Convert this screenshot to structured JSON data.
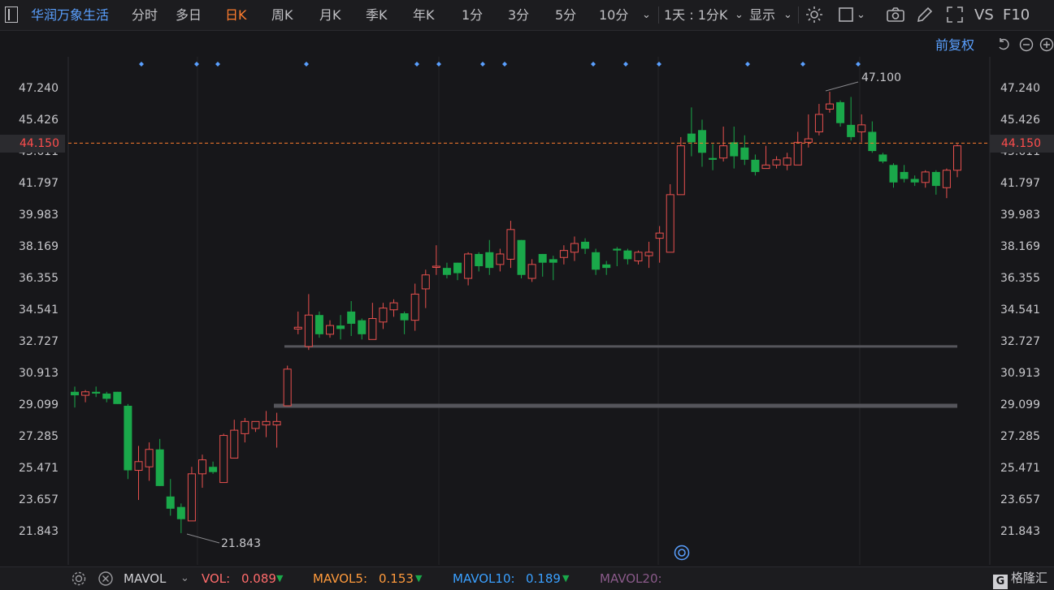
{
  "toolbar": {
    "stock_name": "华润万象生活",
    "periods": [
      "分时",
      "多日",
      "日K",
      "周K",
      "月K",
      "季K",
      "年K",
      "1分",
      "3分",
      "5分",
      "10分"
    ],
    "active_period": "日K",
    "interval_label": "1天 : 1分K",
    "display_label": "显示",
    "vs_label": "VS",
    "f10_label": "F10"
  },
  "subheader": {
    "adjust_label": "前复权"
  },
  "price_axis": {
    "labels": [
      "47.240",
      "45.426",
      "43.611",
      "41.797",
      "39.983",
      "38.169",
      "36.355",
      "34.541",
      "32.727",
      "30.913",
      "29.099",
      "27.285",
      "25.471",
      "23.657",
      "21.843"
    ]
  },
  "current_price": "44.150",
  "annotations": {
    "high_label": "47.100",
    "low_label": "21.843"
  },
  "colors": {
    "up": "#e8504e",
    "down": "#1aa84a",
    "accent": "#ff7d2e",
    "blue": "#5aa0ff",
    "current_price": "#ff4d4d"
  },
  "chart_data": {
    "type": "candlestick",
    "ylim": [
      21.0,
      48.0
    ],
    "candles": [
      {
        "o": 29.9,
        "c": 29.7,
        "h": 30.2,
        "l": 29.0
      },
      {
        "o": 29.7,
        "c": 29.9,
        "h": 30.0,
        "l": 29.3
      },
      {
        "o": 29.9,
        "c": 29.8,
        "h": 30.2,
        "l": 29.6
      },
      {
        "o": 29.8,
        "c": 29.5,
        "h": 29.9,
        "l": 29.3
      },
      {
        "o": 29.9,
        "c": 29.2,
        "h": 29.9,
        "l": 29.2
      },
      {
        "o": 29.1,
        "c": 25.4,
        "h": 29.2,
        "l": 24.9
      },
      {
        "o": 25.4,
        "c": 25.9,
        "h": 26.8,
        "l": 23.7
      },
      {
        "o": 25.6,
        "c": 26.6,
        "h": 27.0,
        "l": 24.8
      },
      {
        "o": 26.6,
        "c": 24.5,
        "h": 27.2,
        "l": 24.5
      },
      {
        "o": 23.9,
        "c": 23.2,
        "h": 24.9,
        "l": 22.8
      },
      {
        "o": 23.3,
        "c": 22.6,
        "h": 23.5,
        "l": 21.8
      },
      {
        "o": 22.5,
        "c": 25.2,
        "h": 25.6,
        "l": 22.5
      },
      {
        "o": 25.2,
        "c": 26.0,
        "h": 26.3,
        "l": 24.4
      },
      {
        "o": 25.6,
        "c": 25.3,
        "h": 25.9,
        "l": 25.2
      },
      {
        "o": 24.7,
        "c": 27.4,
        "h": 27.5,
        "l": 24.7
      },
      {
        "o": 26.1,
        "c": 27.7,
        "h": 28.3,
        "l": 26.1
      },
      {
        "o": 27.5,
        "c": 28.2,
        "h": 28.4,
        "l": 27.0
      },
      {
        "o": 27.8,
        "c": 28.2,
        "h": 28.2,
        "l": 27.6
      },
      {
        "o": 28.0,
        "c": 28.2,
        "h": 28.8,
        "l": 27.3
      },
      {
        "o": 28.0,
        "c": 28.2,
        "h": 28.7,
        "l": 26.7
      },
      {
        "o": 29.1,
        "c": 31.2,
        "h": 31.4,
        "l": 29.1
      },
      {
        "o": 33.5,
        "c": 33.6,
        "h": 34.5,
        "l": 33.2
      },
      {
        "o": 32.5,
        "c": 34.3,
        "h": 35.5,
        "l": 32.3
      },
      {
        "o": 34.3,
        "c": 33.2,
        "h": 34.5,
        "l": 33.0
      },
      {
        "o": 33.2,
        "c": 33.7,
        "h": 34.0,
        "l": 33.0
      },
      {
        "o": 33.7,
        "c": 33.5,
        "h": 34.3,
        "l": 32.9
      },
      {
        "o": 34.5,
        "c": 33.8,
        "h": 35.1,
        "l": 33.1
      },
      {
        "o": 34.0,
        "c": 33.2,
        "h": 34.1,
        "l": 32.9
      },
      {
        "o": 32.9,
        "c": 34.1,
        "h": 35.0,
        "l": 32.9
      },
      {
        "o": 33.9,
        "c": 34.7,
        "h": 35.0,
        "l": 33.5
      },
      {
        "o": 34.6,
        "c": 35.0,
        "h": 35.2,
        "l": 34.2
      },
      {
        "o": 34.4,
        "c": 34.0,
        "h": 34.5,
        "l": 33.2
      },
      {
        "o": 34.0,
        "c": 35.5,
        "h": 36.1,
        "l": 33.4
      },
      {
        "o": 35.8,
        "c": 36.6,
        "h": 36.9,
        "l": 34.7
      },
      {
        "o": 37.1,
        "c": 37.1,
        "h": 38.3,
        "l": 36.6
      },
      {
        "o": 37.0,
        "c": 36.6,
        "h": 37.3,
        "l": 36.4
      },
      {
        "o": 37.3,
        "c": 36.7,
        "h": 37.3,
        "l": 36.3
      },
      {
        "o": 36.4,
        "c": 37.8,
        "h": 37.9,
        "l": 36.0
      },
      {
        "o": 37.8,
        "c": 37.1,
        "h": 37.9,
        "l": 36.8
      },
      {
        "o": 37.9,
        "c": 37.0,
        "h": 38.6,
        "l": 36.6
      },
      {
        "o": 37.2,
        "c": 37.8,
        "h": 38.1,
        "l": 36.8
      },
      {
        "o": 37.5,
        "c": 39.2,
        "h": 39.7,
        "l": 37.0
      },
      {
        "o": 38.6,
        "c": 36.6,
        "h": 38.6,
        "l": 36.4
      },
      {
        "o": 36.4,
        "c": 37.2,
        "h": 37.5,
        "l": 36.2
      },
      {
        "o": 37.8,
        "c": 37.3,
        "h": 37.8,
        "l": 36.5
      },
      {
        "o": 37.5,
        "c": 37.3,
        "h": 37.7,
        "l": 36.3
      },
      {
        "o": 37.6,
        "c": 38.0,
        "h": 38.3,
        "l": 37.2
      },
      {
        "o": 37.9,
        "c": 38.4,
        "h": 38.8,
        "l": 37.4
      },
      {
        "o": 38.5,
        "c": 38.1,
        "h": 38.7,
        "l": 37.8
      },
      {
        "o": 37.9,
        "c": 36.9,
        "h": 38.1,
        "l": 36.6
      },
      {
        "o": 37.2,
        "c": 37.0,
        "h": 37.4,
        "l": 36.6
      },
      {
        "o": 38.1,
        "c": 38.0,
        "h": 38.2,
        "l": 37.1
      },
      {
        "o": 38.0,
        "c": 37.5,
        "h": 38.1,
        "l": 37.2
      },
      {
        "o": 37.4,
        "c": 37.9,
        "h": 38.0,
        "l": 37.2
      },
      {
        "o": 37.7,
        "c": 37.9,
        "h": 38.5,
        "l": 37.0
      },
      {
        "o": 38.7,
        "c": 39.0,
        "h": 39.4,
        "l": 37.3
      },
      {
        "o": 37.9,
        "c": 41.2,
        "h": 41.8,
        "l": 37.9
      },
      {
        "o": 41.2,
        "c": 44.0,
        "h": 44.5,
        "l": 41.2
      },
      {
        "o": 44.7,
        "c": 44.2,
        "h": 46.2,
        "l": 43.4
      },
      {
        "o": 44.9,
        "c": 43.6,
        "h": 45.5,
        "l": 42.8
      },
      {
        "o": 43.3,
        "c": 43.2,
        "h": 44.1,
        "l": 42.6
      },
      {
        "o": 43.3,
        "c": 44.0,
        "h": 45.1,
        "l": 43.1
      },
      {
        "o": 44.2,
        "c": 43.4,
        "h": 45.1,
        "l": 42.7
      },
      {
        "o": 43.9,
        "c": 43.2,
        "h": 44.6,
        "l": 42.9
      },
      {
        "o": 43.2,
        "c": 42.5,
        "h": 43.5,
        "l": 42.3
      },
      {
        "o": 42.7,
        "c": 42.9,
        "h": 44.0,
        "l": 42.7
      },
      {
        "o": 42.9,
        "c": 43.2,
        "h": 43.4,
        "l": 42.7
      },
      {
        "o": 42.9,
        "c": 43.3,
        "h": 43.6,
        "l": 42.6
      },
      {
        "o": 42.9,
        "c": 44.2,
        "h": 44.8,
        "l": 42.9
      },
      {
        "o": 44.2,
        "c": 44.4,
        "h": 45.8,
        "l": 43.9
      },
      {
        "o": 44.8,
        "c": 45.8,
        "h": 46.4,
        "l": 44.6
      },
      {
        "o": 46.1,
        "c": 46.4,
        "h": 47.1,
        "l": 45.9
      },
      {
        "o": 46.5,
        "c": 45.3,
        "h": 46.6,
        "l": 45.1
      },
      {
        "o": 45.2,
        "c": 44.5,
        "h": 46.8,
        "l": 44.3
      },
      {
        "o": 44.8,
        "c": 45.2,
        "h": 45.8,
        "l": 44.2
      },
      {
        "o": 44.8,
        "c": 43.7,
        "h": 45.4,
        "l": 43.6
      },
      {
        "o": 43.5,
        "c": 43.1,
        "h": 43.6,
        "l": 43.0
      },
      {
        "o": 42.9,
        "c": 41.9,
        "h": 43.0,
        "l": 41.6
      },
      {
        "o": 42.5,
        "c": 42.1,
        "h": 42.9,
        "l": 41.9
      },
      {
        "o": 42.1,
        "c": 41.9,
        "h": 42.3,
        "l": 41.7
      },
      {
        "o": 41.9,
        "c": 42.5,
        "h": 42.6,
        "l": 41.6
      },
      {
        "o": 42.5,
        "c": 41.7,
        "h": 42.6,
        "l": 41.2
      },
      {
        "o": 41.6,
        "c": 42.6,
        "h": 42.7,
        "l": 41.0
      },
      {
        "o": 42.6,
        "c": 44.0,
        "h": 44.1,
        "l": 42.2
      }
    ],
    "support_lines": [
      32.5,
      29.1
    ],
    "current_price": 44.15
  },
  "bottom": {
    "indicator": "MAVOL",
    "vol_label": "VOL:",
    "vol_value": "0.089",
    "ma5_label": "MAVOL5:",
    "ma5_value": "0.153",
    "ma10_label": "MAVOL10:",
    "ma10_value": "0.189",
    "ma20_label": "MAVOL20:",
    "logo_text": "格隆汇"
  }
}
